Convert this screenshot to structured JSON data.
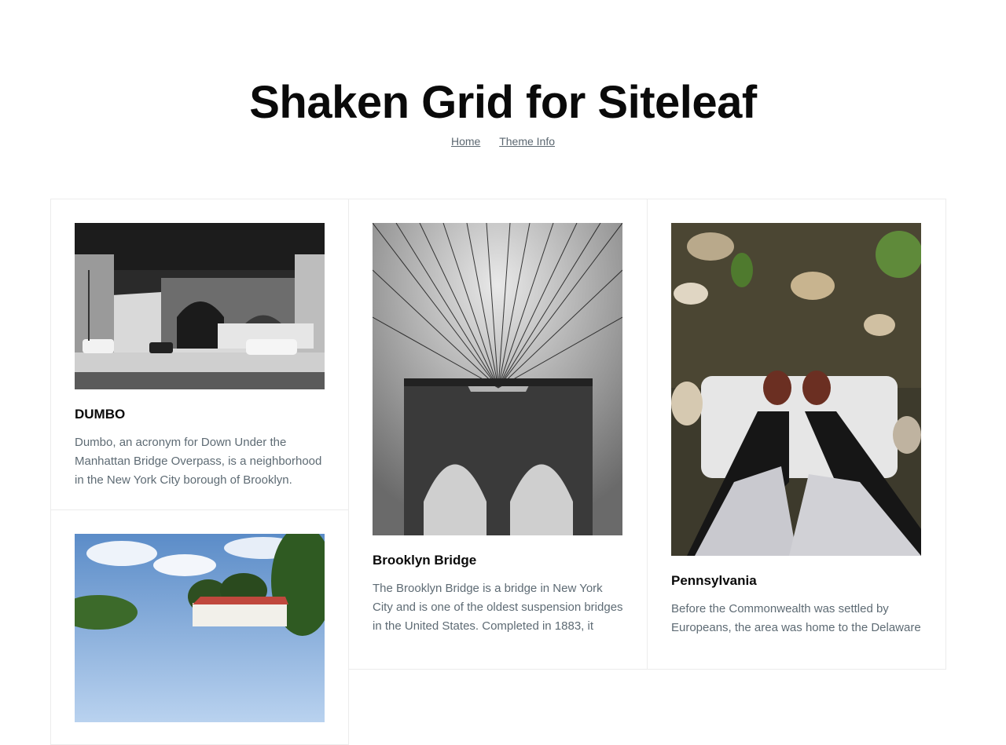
{
  "site": {
    "title": "Shaken Grid for Siteleaf"
  },
  "nav": [
    {
      "label": "Home"
    },
    {
      "label": "Theme Info"
    }
  ],
  "posts": [
    {
      "title": "DUMBO",
      "excerpt": "Dumbo, an acronym for Down Under the Manhattan Bridge Overpass, is a neighborhood in the New York City borough of Brooklyn.",
      "image": "photo-dumbo-underpass"
    },
    {
      "title": "Brooklyn Bridge",
      "excerpt": "The Brooklyn Bridge is a bridge in New York City and is one of the oldest suspension bridges in the United States. Completed in 1883, it",
      "image": "photo-brooklyn-bridge"
    },
    {
      "title": "Pennsylvania",
      "excerpt": "Before the Commonwealth was settled by Europeans, the area was home to the Delaware",
      "image": "photo-boots-on-rocks"
    },
    {
      "title": "",
      "excerpt": "",
      "image": "photo-house-trees-sky"
    }
  ]
}
